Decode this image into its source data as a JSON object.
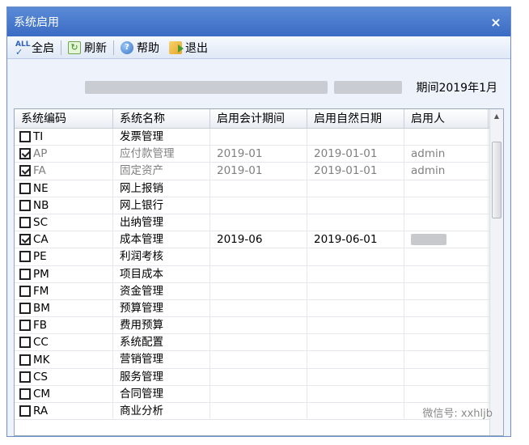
{
  "window": {
    "title": "系统启用",
    "close": "×"
  },
  "toolbar": {
    "select_all": "全启",
    "refresh": "刷新",
    "help": "帮助",
    "exit": "退出",
    "select_all_icon_text": "ALL"
  },
  "info": {
    "period_text": "期间2019年1月"
  },
  "grid": {
    "columns": [
      "系统编码",
      "系统名称",
      "启用会计期间",
      "启用自然日期",
      "启用人"
    ],
    "rows": [
      {
        "checked": false,
        "code": "TI",
        "name": "发票管理",
        "period": "",
        "date": "",
        "user": "",
        "dim": false
      },
      {
        "checked": true,
        "code": "AP",
        "name": "应付款管理",
        "period": "2019-01",
        "date": "2019-01-01",
        "user": "admin",
        "dim": true
      },
      {
        "checked": true,
        "code": "FA",
        "name": "固定资产",
        "period": "2019-01",
        "date": "2019-01-01",
        "user": "admin",
        "dim": true
      },
      {
        "checked": false,
        "code": "NE",
        "name": "网上报销",
        "period": "",
        "date": "",
        "user": "",
        "dim": false
      },
      {
        "checked": false,
        "code": "NB",
        "name": "网上银行",
        "period": "",
        "date": "",
        "user": "",
        "dim": false
      },
      {
        "checked": false,
        "code": "SC",
        "name": "出纳管理",
        "period": "",
        "date": "",
        "user": "",
        "dim": false
      },
      {
        "checked": true,
        "code": "CA",
        "name": "成本管理",
        "period": "2019-06",
        "date": "2019-06-01",
        "user": "",
        "dim": false
      },
      {
        "checked": false,
        "code": "PE",
        "name": "利润考核",
        "period": "",
        "date": "",
        "user": "",
        "dim": false
      },
      {
        "checked": false,
        "code": "PM",
        "name": "项目成本",
        "period": "",
        "date": "",
        "user": "",
        "dim": false
      },
      {
        "checked": false,
        "code": "FM",
        "name": "资金管理",
        "period": "",
        "date": "",
        "user": "",
        "dim": false
      },
      {
        "checked": false,
        "code": "BM",
        "name": "预算管理",
        "period": "",
        "date": "",
        "user": "",
        "dim": false
      },
      {
        "checked": false,
        "code": "FB",
        "name": "费用预算",
        "period": "",
        "date": "",
        "user": "",
        "dim": false
      },
      {
        "checked": false,
        "code": "CC",
        "name": "系统配置",
        "period": "",
        "date": "",
        "user": "",
        "dim": false
      },
      {
        "checked": false,
        "code": "MK",
        "name": "营销管理",
        "period": "",
        "date": "",
        "user": "",
        "dim": false
      },
      {
        "checked": false,
        "code": "CS",
        "name": "服务管理",
        "period": "",
        "date": "",
        "user": "",
        "dim": false
      },
      {
        "checked": false,
        "code": "CM",
        "name": "合同管理",
        "period": "",
        "date": "",
        "user": "",
        "dim": false
      },
      {
        "checked": false,
        "code": "RA",
        "name": "商业分析",
        "period": "",
        "date": "",
        "user": "",
        "dim": false
      }
    ]
  },
  "watermark": "微信号: xxhljb"
}
